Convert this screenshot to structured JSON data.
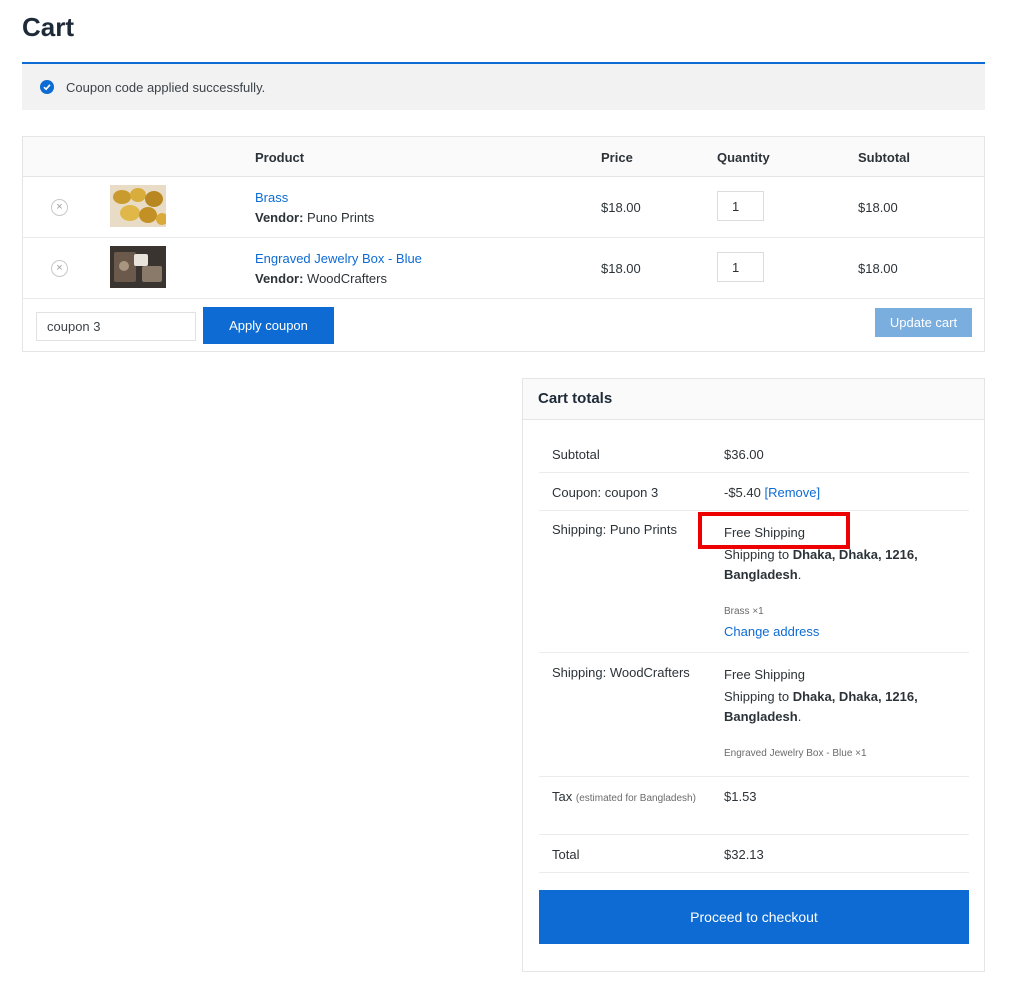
{
  "page": {
    "title": "Cart"
  },
  "notice": {
    "message": "Coupon code applied successfully."
  },
  "cart": {
    "headers": {
      "product": "Product",
      "price": "Price",
      "quantity": "Quantity",
      "subtotal": "Subtotal"
    },
    "remove_symbol": "×",
    "vendor_label": "Vendor:",
    "items": [
      {
        "name": "Brass",
        "vendor": "Puno Prints",
        "price": "$18.00",
        "quantity": "1",
        "subtotal": "$18.00"
      },
      {
        "name": "Engraved Jewelry Box - Blue",
        "vendor": "WoodCrafters",
        "price": "$18.00",
        "quantity": "1",
        "subtotal": "$18.00"
      }
    ],
    "coupon_value": "coupon 3",
    "apply_label": "Apply coupon",
    "update_label": "Update cart"
  },
  "totals": {
    "title": "Cart totals",
    "subtotal_label": "Subtotal",
    "subtotal_value": "$36.00",
    "coupon_label": "Coupon: coupon 3",
    "coupon_value": "-$5.40",
    "coupon_remove": "[Remove]",
    "shipping": [
      {
        "label": "Shipping: Puno Prints",
        "method": "Free Shipping",
        "to_prefix": "Shipping to",
        "address": "Dhaka, Dhaka, 1216, Bangladesh",
        "period": ".",
        "items": "Brass ×1",
        "change_link": "Change address"
      },
      {
        "label": "Shipping: WoodCrafters",
        "method": "Free Shipping",
        "to_prefix": "Shipping to",
        "address": "Dhaka, Dhaka, 1216, Bangladesh",
        "period": ".",
        "items": "Engraved Jewelry Box - Blue ×1"
      }
    ],
    "tax_label": "Tax",
    "tax_note": "(estimated for Bangladesh)",
    "tax_value": "$1.53",
    "total_label": "Total",
    "total_value": "$32.13",
    "checkout_label": "Proceed to checkout"
  },
  "colors": {
    "accent": "#0d6bd3",
    "disabled_button": "#7aaedf",
    "highlight": "#ee0000"
  }
}
